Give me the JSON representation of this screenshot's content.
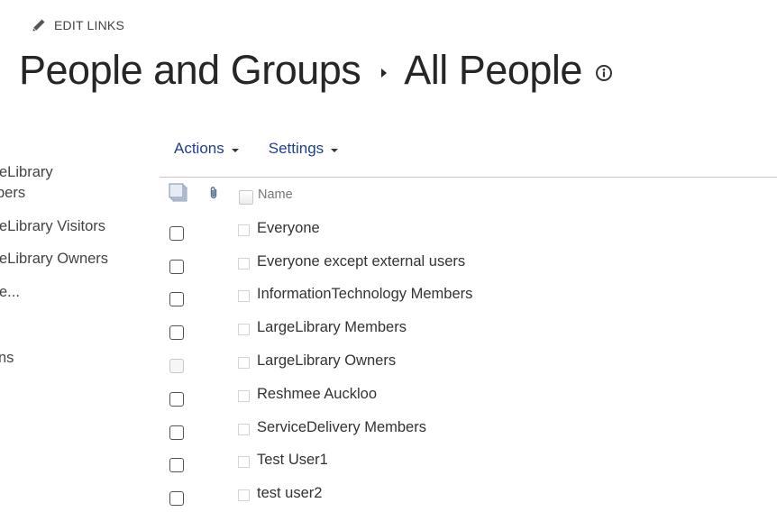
{
  "edit_links": {
    "label": "EDIT LINKS",
    "icon": "pencil-icon"
  },
  "title": {
    "parent": "People and Groups",
    "separator_icon": "breadcrumb-arrow-icon",
    "current": "All People",
    "info_icon": "info-icon"
  },
  "left_nav": {
    "items": [
      {
        "label": "eLibrary"
      },
      {
        "label": "bers"
      },
      {
        "label": "eLibrary Visitors"
      },
      {
        "label": "eLibrary Owners"
      },
      {
        "label": "e..."
      },
      {
        "label": "ns"
      }
    ]
  },
  "toolbar": {
    "actions_label": "Actions",
    "settings_label": "Settings"
  },
  "list_header": {
    "type_icon": "type-icon",
    "attachment_icon": "attachment-icon",
    "name_column": "Name"
  },
  "rows": [
    {
      "name": "Everyone",
      "dimmed": false
    },
    {
      "name": "Everyone except external users",
      "dimmed": false
    },
    {
      "name": "InformationTechnology Members",
      "dimmed": false
    },
    {
      "name": "LargeLibrary Members",
      "dimmed": false
    },
    {
      "name": "LargeLibrary Owners",
      "dimmed": true
    },
    {
      "name": "Reshmee Auckloo",
      "dimmed": false
    },
    {
      "name": "ServiceDelivery Members",
      "dimmed": false
    },
    {
      "name": "Test User1",
      "dimmed": false
    },
    {
      "name": "test user2",
      "dimmed": false
    }
  ],
  "colors": {
    "link": "#1e3f8f",
    "title": "#262626",
    "divider": "#c6c6c6"
  }
}
